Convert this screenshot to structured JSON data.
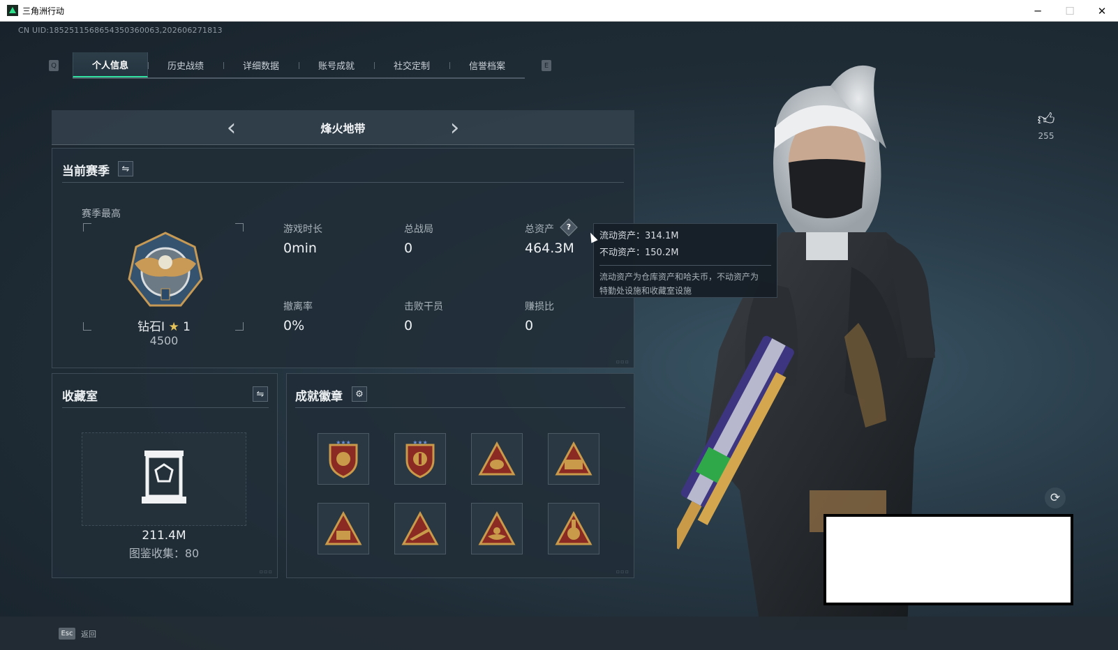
{
  "window": {
    "title": "三角洲行动",
    "controls": {
      "minimize": "─",
      "maximize": "☐",
      "close": "✕"
    }
  },
  "uid": "CN UID:1852511568654350360063,202606271813",
  "tabs": {
    "left_key": "Q",
    "right_key": "E",
    "items": [
      {
        "label": "个人信息",
        "active": true
      },
      {
        "label": "历史战绩",
        "active": false
      },
      {
        "label": "详细数据",
        "active": false
      },
      {
        "label": "账号成就",
        "active": false
      },
      {
        "label": "社交定制",
        "active": false
      },
      {
        "label": "信誉档案",
        "active": false
      }
    ]
  },
  "mode": {
    "prev": "‹",
    "name": "烽火地带",
    "next": "›"
  },
  "season": {
    "title": "当前赛季",
    "best_label": "赛季最高",
    "rank_name": "钻石Ⅰ",
    "rank_star": "★",
    "rank_stars_count": "1",
    "rank_score": "4500",
    "stats": [
      {
        "label": "游戏时长",
        "value": "0min"
      },
      {
        "label": "总战局",
        "value": "0"
      },
      {
        "label": "总资产",
        "value": "464.3M"
      },
      {
        "label": "撤离率",
        "value": "0%"
      },
      {
        "label": "击败干员",
        "value": "0"
      },
      {
        "label": "赚损比",
        "value": "0"
      }
    ],
    "help_icon": "?"
  },
  "tooltip": {
    "liquid": "流动资产：314.1M",
    "fixed": "不动资产：150.2M",
    "desc_line1": "流动资产为仓库资产和哈夫币，不动资产为",
    "desc_line2": "特勤处设施和收藏室设施"
  },
  "collection": {
    "title": "收藏室",
    "value": "211.4M",
    "count": "图鉴收集：80"
  },
  "achievements": {
    "title": "成就徽章",
    "badge_count": 8
  },
  "likes": {
    "count": "255"
  },
  "footer": {
    "esc_key": "Esc",
    "back_label": "返回"
  },
  "colors": {
    "accent": "#2fe0a0",
    "panel_bg": "#212d38",
    "gold": "#c9974a",
    "red": "#8a2a22"
  }
}
